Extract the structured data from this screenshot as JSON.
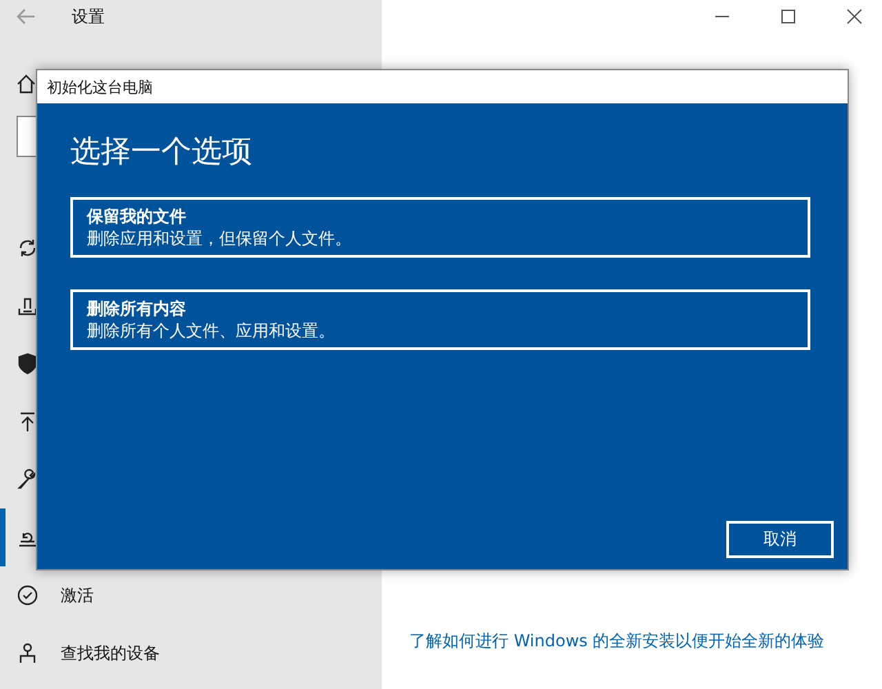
{
  "window": {
    "title": "设置"
  },
  "sidebar": {
    "items": [
      {
        "selected": false
      },
      {
        "selected": false
      },
      {
        "selected": false
      },
      {
        "selected": false
      },
      {
        "selected": false
      },
      {
        "selected": true
      },
      {
        "label": "激活",
        "selected": false
      },
      {
        "label": "查找我的设备",
        "selected": false
      }
    ]
  },
  "content": {
    "link": "了解如何进行 Windows 的全新安装以便开始全新的体验"
  },
  "dialog": {
    "title": "初始化这台电脑",
    "heading": "选择一个选项",
    "options": [
      {
        "title": "保留我的文件",
        "description": "删除应用和设置，但保留个人文件。"
      },
      {
        "title": "删除所有内容",
        "description": "删除所有个人文件、应用和设置。"
      }
    ],
    "cancel_button": "取消"
  }
}
